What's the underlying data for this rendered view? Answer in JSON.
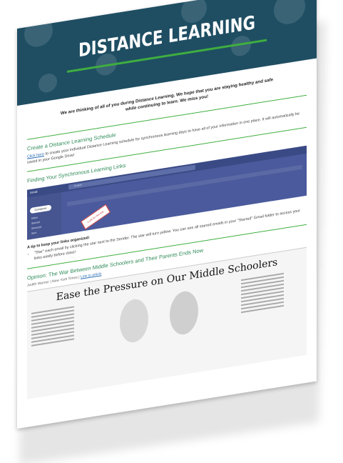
{
  "header": {
    "title": "DISTANCE LEARNING",
    "intro": "We are thinking of all of you during Distance Learning. We hope that you are staying healthy and safe while continuing to learn. We miss you!"
  },
  "sections": [
    {
      "title": "Create a Distance Learning Schedule",
      "link_text": "Click here",
      "body": " to create your individual Distance Learning schedule for synchronous learning days to have all of your information in one place. It will automatically be saved in your Google Drive!"
    },
    {
      "title": "Finding Your Synchronous Learning Links",
      "screenshot": {
        "app": "Gmail",
        "compose": "Compose",
        "search": "in:sent",
        "nav": [
          "Inbox",
          "Starred",
          "Snoozed",
          "Sent"
        ],
        "callout": "Look for the link"
      },
      "tips_heading": "A tip to keep your links organized:",
      "tips": [
        "\"Star\" each email by clicking the star next to the Sender. The star will turn yellow. You can see all starred emails in your \"Starred\" Gmail folder to access your links easily before class!"
      ]
    },
    {
      "title": "Opinion: The War Between Middle Schoolers and Their Parents Ends Now",
      "byline": "Judith Warner | New York Times |",
      "byline_link": "Link to article",
      "clipping_headline": "Ease the Pressure on Our Middle Schoolers"
    }
  ]
}
